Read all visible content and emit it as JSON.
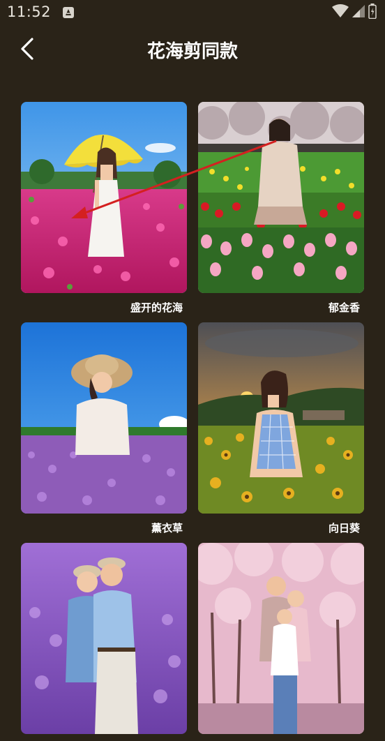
{
  "status_bar": {
    "time": "11:52"
  },
  "header": {
    "title": "花海剪同款"
  },
  "templates": [
    {
      "caption": "盛开的花海"
    },
    {
      "caption": "郁金香"
    },
    {
      "caption": "薰衣草"
    },
    {
      "caption": "向日葵"
    },
    {
      "caption": ""
    },
    {
      "caption": ""
    }
  ],
  "colors": {
    "background": "#2a2318",
    "annotation_arrow": "#d42020"
  }
}
